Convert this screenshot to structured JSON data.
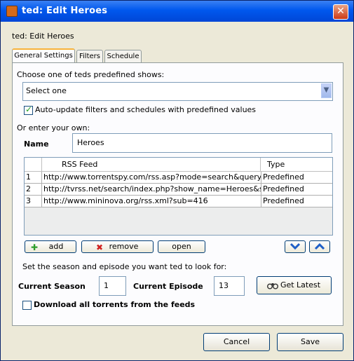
{
  "window": {
    "title": "ted: Edit Heroes",
    "close_glyph": "✕"
  },
  "heading": "ted: Edit Heroes",
  "tabs": [
    {
      "label": "General Settings",
      "active": true
    },
    {
      "label": "Filters",
      "active": false
    },
    {
      "label": "Schedule",
      "active": false
    }
  ],
  "predefined": {
    "label": "Choose one of teds predefined shows:",
    "selected": "Select one",
    "auto_update_label": "Auto-update filters and schedules with predefined values",
    "auto_update_checked": true
  },
  "own": {
    "label": "Or enter your own:",
    "name_label": "Name",
    "name_value": "Heroes"
  },
  "feeds_table": {
    "columns": [
      "",
      "RSS Feed",
      "Type"
    ],
    "rows": [
      {
        "num": "1",
        "feed": "http://www.torrentspy.com/rss.asp?mode=search&query=he...",
        "type": "Predefined"
      },
      {
        "num": "2",
        "feed": "http://tvrss.net/search/index.php?show_name=Heroes&sho...",
        "type": "Predefined"
      },
      {
        "num": "3",
        "feed": "http://www.mininova.org/rss.xml?sub=416",
        "type": "Predefined"
      }
    ]
  },
  "feed_buttons": {
    "add": "add",
    "remove": "remove",
    "open": "open"
  },
  "episode": {
    "prompt": "Set the season and episode you want ted to look for:",
    "season_label": "Current Season",
    "season_value": "1",
    "episode_label": "Current Episode",
    "episode_value": "13",
    "get_latest": "Get Latest"
  },
  "download_all": {
    "label": "Download all torrents from the feeds",
    "checked": false
  },
  "footer": {
    "cancel": "Cancel",
    "save": "Save"
  },
  "colors": {
    "title_bar": "#0058ee",
    "window_bg": "#ece9d8",
    "accent_tab": "#f8b33a",
    "close": "#cc3a17"
  }
}
